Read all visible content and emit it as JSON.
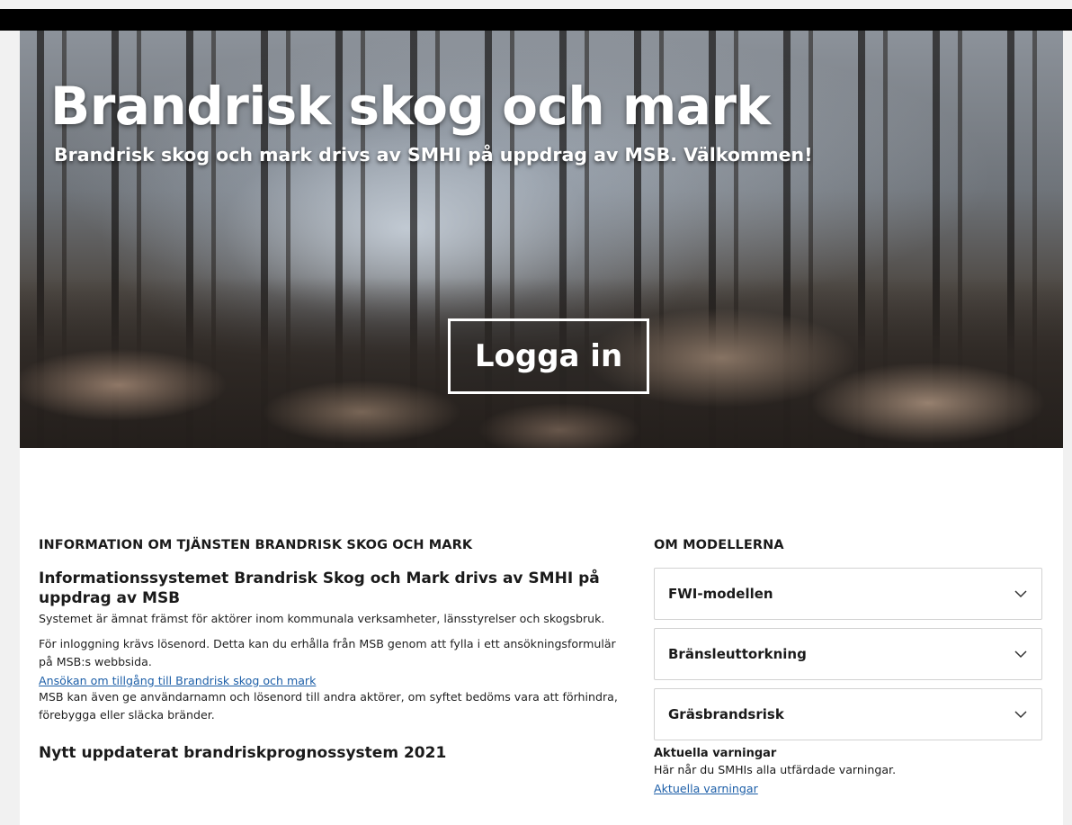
{
  "hero": {
    "title": "Brandrisk skog och mark",
    "subtitle": "Brandrisk skog och mark drivs av SMHI på uppdrag av MSB. Välkommen!",
    "login_label": "Logga in"
  },
  "info": {
    "section_heading": "INFORMATION OM TJÄNSTEN BRANDRISK SKOG OCH MARK",
    "heading": "Informationssystemet Brandrisk Skog och Mark drivs av SMHI på uppdrag av MSB",
    "paragraph1": "Systemet är ämnat främst för aktörer inom kommunala verksamheter, länsstyrelser och skogsbruk.",
    "paragraph2": "För inloggning krävs lösenord. Detta kan du erhålla från MSB genom att fylla i ett ansökningsformulär på MSB:s webbsida.",
    "apply_link": "Ansökan om tillgång till Brandrisk skog och mark",
    "paragraph3": "MSB kan även ge användarnamn och lösenord till andra aktörer, om syftet bedöms vara att förhindra, förebygga eller släcka bränder.",
    "new_system_heading": "Nytt uppdaterat brandriskprognossystem 2021"
  },
  "models": {
    "section_heading": "OM MODELLERNA",
    "items": [
      {
        "label": "FWI-modellen",
        "icon": "chevron-down-icon"
      },
      {
        "label": "Bränsleuttorkning",
        "icon": "chevron-down-icon"
      },
      {
        "label": "Gräsbrandsrisk",
        "icon": "chevron-down-icon"
      }
    ]
  },
  "warnings": {
    "title": "Aktuella varningar",
    "text": "Här når du SMHIs alla utfärdade varningar.",
    "link": "Aktuella varningar"
  },
  "colors": {
    "link": "#1d5fa8",
    "topbar": "#000000",
    "page_background": "#f1f1f1"
  }
}
